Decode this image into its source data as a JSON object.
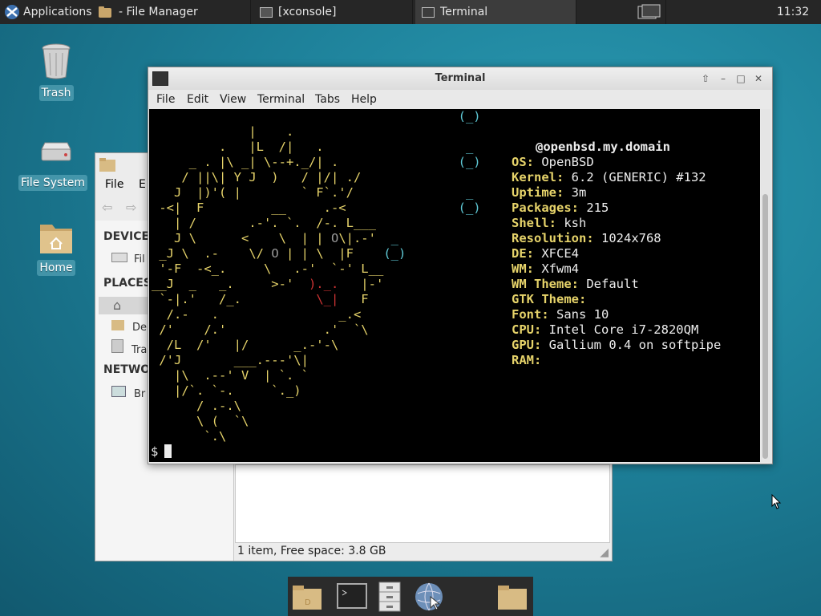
{
  "top_panel": {
    "applications": "Applications",
    "tasks": [
      {
        "label": "- File Manager"
      },
      {
        "label": "[xconsole]"
      },
      {
        "label": "Terminal"
      }
    ],
    "clock": "11:32"
  },
  "desktop": {
    "icons": [
      {
        "label": "Trash"
      },
      {
        "label": "File System"
      },
      {
        "label": "Home"
      }
    ]
  },
  "file_manager": {
    "menu": {
      "file": "File",
      "edit_partial": "E"
    },
    "sections": {
      "devices": "DEVICE",
      "places": "PLACES",
      "network": "NETWO"
    },
    "rows": {
      "filesystem": "Fil",
      "desktop": "De",
      "trash": "Tra",
      "browse": "Br"
    },
    "status": "1 item, Free space: 3.8 GB"
  },
  "terminal": {
    "title": "Terminal",
    "menu": [
      "File",
      "Edit",
      "View",
      "Terminal",
      "Tabs",
      "Help"
    ],
    "host": "@openbsd.my.domain",
    "info": [
      {
        "k": "OS:",
        "v": " OpenBSD"
      },
      {
        "k": "Kernel:",
        "v": " 6.2 (GENERIC) #132"
      },
      {
        "k": "Uptime:",
        "v": " 3m"
      },
      {
        "k": "Packages:",
        "v": " 215"
      },
      {
        "k": "Shell:",
        "v": " ksh"
      },
      {
        "k": "Resolution:",
        "v": " 1024x768"
      },
      {
        "k": "DE:",
        "v": " XFCE4"
      },
      {
        "k": "WM:",
        "v": " Xfwm4"
      },
      {
        "k": "WM Theme:",
        "v": " Default"
      },
      {
        "k": "GTK Theme:",
        "v": ""
      },
      {
        "k": "Font:",
        "v": " Sans 10"
      },
      {
        "k": "CPU:",
        "v": " Intel Core i7-2820QM"
      },
      {
        "k": "GPU:",
        "v": " Gallium 0.4 on softpipe"
      },
      {
        "k": "RAM:",
        "v": ""
      }
    ],
    "prompt": "$"
  }
}
